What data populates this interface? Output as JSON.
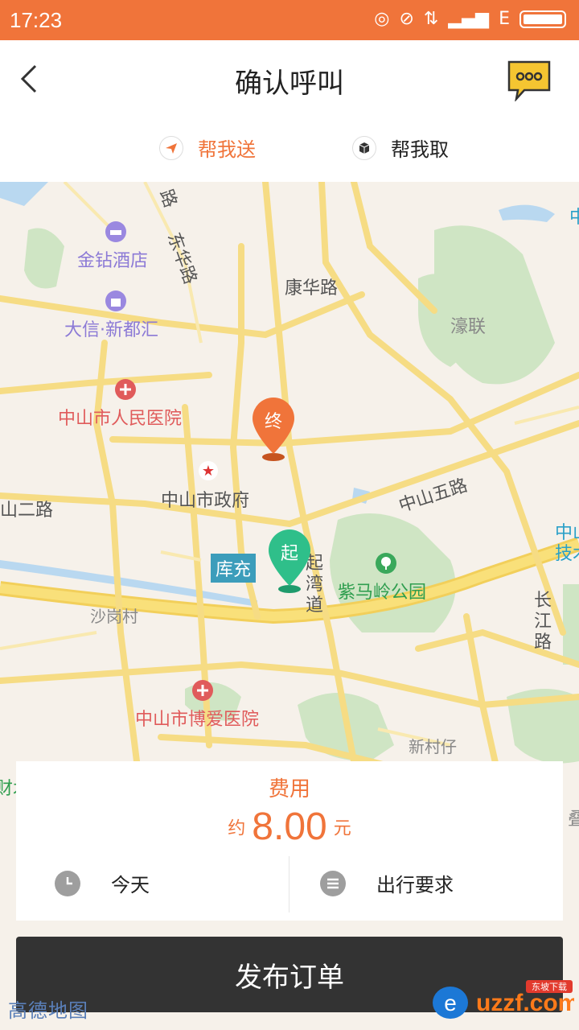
{
  "statusbar": {
    "time": "17:23",
    "network": "E"
  },
  "header": {
    "title": "确认呼叫",
    "back_icon": "chevron-left-icon",
    "chat_icon": "chat-bubble-icon"
  },
  "tabs": [
    {
      "label": "帮我送",
      "icon": "paper-plane-icon",
      "active": true
    },
    {
      "label": "帮我取",
      "icon": "package-icon",
      "active": false
    }
  ],
  "map": {
    "labels": {
      "road_nw": "路",
      "donghua": "东华路",
      "jinzuan": "金钻酒店",
      "kanghua": "康华路",
      "haolian": "濠联",
      "daxin": "大信·新都汇",
      "hospital_people": "中山市人民医院",
      "zhongshan_gov": "中山市政府",
      "zhongshan2": "山二路",
      "zhongshan5": "中山五路",
      "zhong_right": "中",
      "zhongshan_tech": "中山\n技术",
      "kuchong": "库充",
      "qiwan": "起湾道",
      "zimaling": "紫马岭公园",
      "shagang": "沙岗村",
      "changjiang": "长江路",
      "hospital_boai": "中山市博爱医院",
      "xincunzi": "新村仔",
      "edge_left": "财木",
      "edge_right": "叠"
    },
    "pins": {
      "end": {
        "label": "终",
        "color": "#f0743a"
      },
      "start": {
        "label": "起",
        "color": "#2fbf8a"
      }
    },
    "provider": "高德地图"
  },
  "fee": {
    "label": "费用",
    "approx": "约",
    "amount": "8.00",
    "unit": "元"
  },
  "options": {
    "time": {
      "label": "今天",
      "icon": "clock-icon"
    },
    "requirements": {
      "label": "出行要求",
      "icon": "list-icon"
    }
  },
  "submit_label": "发布订单",
  "watermark": "uzzf.com",
  "watermark_badge": "东坡下载",
  "colors": {
    "accent": "#f0743a",
    "start": "#2fbf8a",
    "submit_bg": "#333333"
  }
}
